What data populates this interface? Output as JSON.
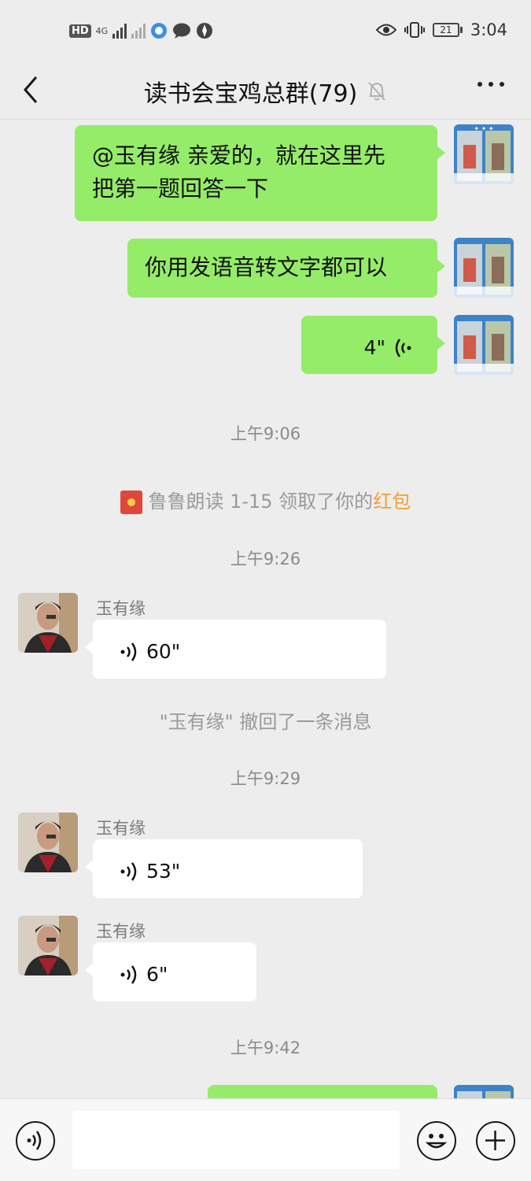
{
  "status_bar": {
    "left_icons": [
      "HD",
      "4G",
      "signal",
      "signal-off",
      "app-icon",
      "chat-bubble-icon",
      "compass-icon"
    ],
    "hd_label": "HD",
    "network": "4G",
    "battery": "21",
    "time": "3:04"
  },
  "header": {
    "title": "读书会宝鸡总群(79)",
    "mute_icon": "bell-off-icon",
    "back_icon": "chevron-left-icon",
    "more_icon": "more-dots-icon"
  },
  "messages": {
    "m1": {
      "text_line1": "@玉有缘  亲爱的，就在这里先",
      "text_line2": "把第一题回答一下"
    },
    "m2": {
      "text": "你用发语音转文字都可以"
    },
    "m3": {
      "duration": "4\""
    },
    "t1": "上午9:06",
    "redpacket": {
      "prefix": "鲁鲁朗读 1-15 领取了你的",
      "link": "红包"
    },
    "t2": "上午9:26",
    "v1": {
      "sender": "玉有缘",
      "duration": "60\""
    },
    "recall": "\"玉有缘\" 撤回了一条消息",
    "t3": "上午9:29",
    "v2": {
      "sender": "玉有缘",
      "duration": "53\""
    },
    "v3": {
      "sender": "玉有缘",
      "duration": "6\""
    },
    "t4": "上午9:42"
  },
  "bottom_bar": {
    "voice_icon": "voice-input-icon",
    "emoji_icon": "emoji-icon",
    "plus_icon": "plus-icon",
    "input_value": ""
  },
  "colors": {
    "my_bubble": "#95ec69",
    "other_bubble": "#ffffff",
    "background": "#ededed",
    "redpacket_link": "#f39f3a"
  }
}
